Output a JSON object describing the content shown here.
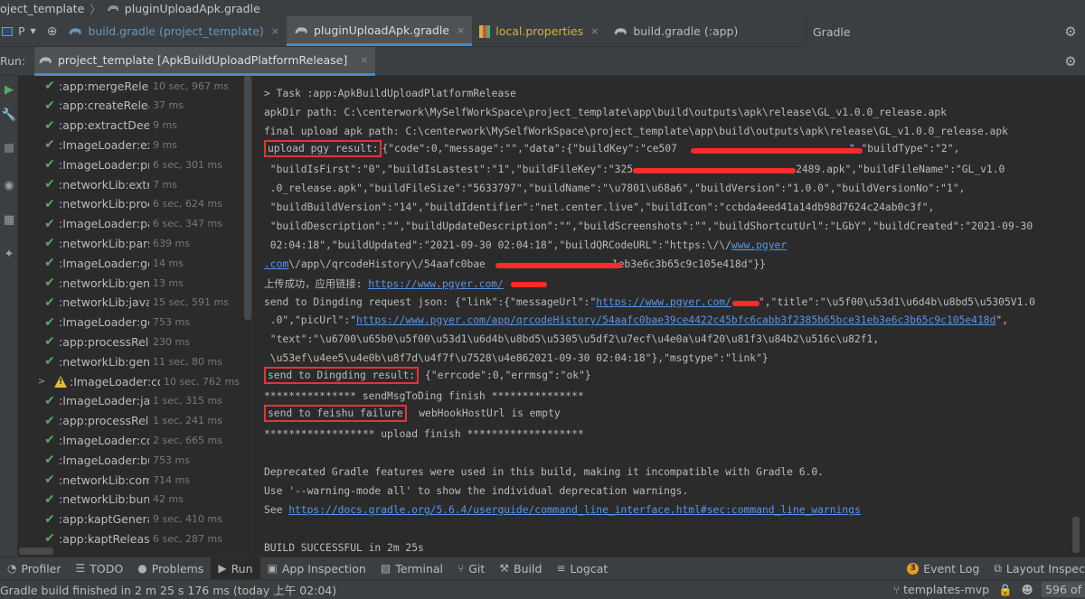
{
  "breadcrumb": {
    "project": "oject_template",
    "file": "pluginUploadApk.gradle"
  },
  "editor_tabs": {
    "project_selector": "P",
    "tabs": [
      {
        "label": "build.gradle (project_template)",
        "style": "blue"
      },
      {
        "label": "pluginUploadApk.gradle",
        "style": "active"
      },
      {
        "label": "local.properties",
        "style": "yellow"
      },
      {
        "label": "build.gradle (:app)",
        "style": "normal"
      }
    ],
    "close_glyph": "×"
  },
  "gradle_panel": {
    "title": "Gradle"
  },
  "run": {
    "label": "Run:",
    "tab": "project_template [ApkBuildUploadPlatformRelease]",
    "close_glyph": "×"
  },
  "tree": {
    "rows": [
      {
        "name": ":app:mergeRelea",
        "time": "10 sec, 967 ms",
        "status": "ok"
      },
      {
        "name": ":app:createReleaseComp",
        "time": "37 ms",
        "status": "ok"
      },
      {
        "name": ":app:extractDeepLinksRel",
        "time": "9 ms",
        "status": "ok"
      },
      {
        "name": ":ImageLoader:extractDeep",
        "time": "9 ms",
        "status": "ok"
      },
      {
        "name": ":ImageLoader:pro",
        "time": "6 sec, 301 ms",
        "status": "ok"
      },
      {
        "name": ":networkLib:extractDeepLi",
        "time": "7 ms",
        "status": "ok"
      },
      {
        "name": ":networkLib:proce",
        "time": "6 sec, 624 ms",
        "status": "ok"
      },
      {
        "name": ":ImageLoader:pars",
        "time": "6 sec, 347 ms",
        "status": "ok"
      },
      {
        "name": ":networkLib:parseReleas",
        "time": "639 ms",
        "status": "ok"
      },
      {
        "name": ":ImageLoader:generateR",
        "time": "14 ms",
        "status": "ok"
      },
      {
        "name": ":networkLib:generateRel",
        "time": "13 ms",
        "status": "ok"
      },
      {
        "name": ":networkLib:javaP",
        "time": "15 sec, 591 ms",
        "status": "ok"
      },
      {
        "name": ":ImageLoader:generate",
        "time": "753 ms",
        "status": "ok"
      },
      {
        "name": ":app:processReleaseMa",
        "time": "230 ms",
        "status": "ok"
      },
      {
        "name": ":networkLib:gener",
        "time": "11 sec, 80 ms",
        "status": "ok"
      },
      {
        "name": ":ImageLoader:co",
        "time": "10 sec, 762 ms",
        "status": "warn",
        "expandable": true
      },
      {
        "name": ":ImageLoader:java",
        "time": "1 sec, 315 ms",
        "status": "ok"
      },
      {
        "name": ":app:processRelea",
        "time": "1 sec, 241 ms",
        "status": "ok"
      },
      {
        "name": ":ImageLoader:con",
        "time": "2 sec, 665 ms",
        "status": "ok"
      },
      {
        "name": ":ImageLoader:bundleLil",
        "time": "753 ms",
        "status": "ok"
      },
      {
        "name": ":networkLib:compileRel",
        "time": "714 ms",
        "status": "ok"
      },
      {
        "name": ":networkLib:bundleLibCo",
        "time": "42 ms",
        "status": "ok"
      },
      {
        "name": ":app:kaptGenerate",
        "time": "9 sec, 410 ms",
        "status": "ok"
      },
      {
        "name": ":app:kaptReleaseK",
        "time": "6 sec, 287 ms",
        "status": "ok"
      }
    ]
  },
  "console": {
    "line1": "> Task :app:ApkBuildUploadPlatformRelease",
    "line2": "apkDir path: C:\\centerwork\\MySelfWorkSpace\\project_template\\app\\build\\outputs\\apk\\release\\GL_v1.0.0_release.apk",
    "line3": "final upload apk path: C:\\centerwork\\MySelfWorkSpace\\project_template\\app\\build\\outputs\\apk\\release\\GL_v1.0.0_release.apk",
    "pgy_label": "upload pgy result:",
    "pgy_a": "{\"code\":0,\"message\":\"\",\"data\":{\"buildKey\":\"ce507",
    "pgy_b": "\",\"buildType\":\"2\",",
    "line5": " \"buildIsFirst\":\"0\",\"buildIsLastest\":\"1\",\"buildFileKey\":\"325",
    "line5b": "2489.apk\",\"buildFileName\":\"GL_v1.0",
    "line6": " .0_release.apk\",\"buildFileSize\":\"5633797\",\"buildName\":\"\\u7801\\u68a6\",\"buildVersion\":\"1.0.0\",\"buildVersionNo\":\"1\",",
    "line7": " \"buildBuildVersion\":\"14\",\"buildIdentifier\":\"net.center.live\",\"buildIcon\":\"ccbda4eed41a14db98d7624c24ab0c3f\",",
    "line8": " \"buildDescription\":\"\",\"buildUpdateDescription\":\"\",\"buildScreenshots\":\"\",\"buildShortcutUrl\":\"LGbY\",\"buildCreated\":\"2021-09-30",
    "line9a": " 02:04:18\",\"buildUpdated\":\"2021-09-30 02:04:18\",\"buildQRCodeURL\":\"https:\\/\\/",
    "line9_link": "www.pgyer",
    "line10_link": ".com",
    "line10b": "\\/app\\/qrcodeHistory\\/54aafc0bae",
    "line10c": "1eb3e6c3b65c9c105e418d\"}}",
    "line11a": "上传成功，应用链接: ",
    "line11_link": "https://www.pgyer.com/",
    "line12a": "send to Dingding request json: {\"link\":{\"messageUrl\":\"",
    "line12_link": "https://www.pgyer.com/",
    "line12b": "\",\"title\":\"\\u5f00\\u53d1\\u6d4b\\u8bd5\\u5305V1.0",
    "line13a": " .0\",\"picUrl\":\"",
    "line13_link": "https://www.pgyer.com/app/qrcodeHistory/54aafc0bae39ce4422c45bfc6cabb3f2385b65bce31eb3e6c3b65c9c105e418d",
    "line13b": "\",",
    "line14": " \"text\":\"\\u6700\\u65b0\\u5f00\\u53d1\\u6d4b\\u8bd5\\u5305\\u5df2\\u7ecf\\u4e0a\\u4f20\\u81f3\\u84b2\\u516c\\u82f1,",
    "line15": " \\u53ef\\u4ee5\\u4e0b\\u8f7d\\u4f7f\\u7528\\u4e862021-09-30 02:04:18\"},\"msgtype\":\"link\"}",
    "ding_label": "send to Dingding result:",
    "ding_value": " {\"errcode\":0,\"errmsg\":\"ok\"}",
    "line17": "*************** sendMsgToDing finish ***************",
    "feishu_label": "send to feishu failure",
    "feishu_value": "  webHookHostUrl is empty",
    "line19": "****************** upload finish *******************",
    "line20": "Deprecated Gradle features were used in this build, making it incompatible with Gradle 6.0.",
    "line21": "Use '--warning-mode all' to show the individual deprecation warnings.",
    "line22a": "See ",
    "line22_link": "https://docs.gradle.org/5.6.4/userguide/command_line_interface.html#sec:command_line_warnings",
    "line23": "BUILD SUCCESSFUL in 2m 25s"
  },
  "tool_windows": [
    {
      "label": "Profiler",
      "icon": "profiler-icon"
    },
    {
      "label": "TODO",
      "icon": "list-icon"
    },
    {
      "label": "Problems",
      "icon": "info-icon"
    },
    {
      "label": "Run",
      "icon": "play-icon",
      "active": true
    },
    {
      "label": "App Inspection",
      "icon": "inspection-icon"
    },
    {
      "label": "Terminal",
      "icon": "terminal-icon"
    },
    {
      "label": "Git",
      "icon": "git-icon"
    },
    {
      "label": "Build",
      "icon": "hammer-icon"
    },
    {
      "label": "Logcat",
      "icon": "logcat-icon"
    }
  ],
  "right_tools": {
    "event_log": "Event Log",
    "event_badge": "3",
    "layout_inspector": "Layout Inspec"
  },
  "status": {
    "message": "Gradle build finished in 2 m 25 s 176 ms (today 上午 02:04)",
    "branch": "templates-mvp",
    "memory": "596 of"
  },
  "colors": {
    "accent": "#4a88c7",
    "ok": "#5ea560",
    "warn": "#e2b93b",
    "highlight": "#e0353a",
    "link": "#5894e8"
  }
}
